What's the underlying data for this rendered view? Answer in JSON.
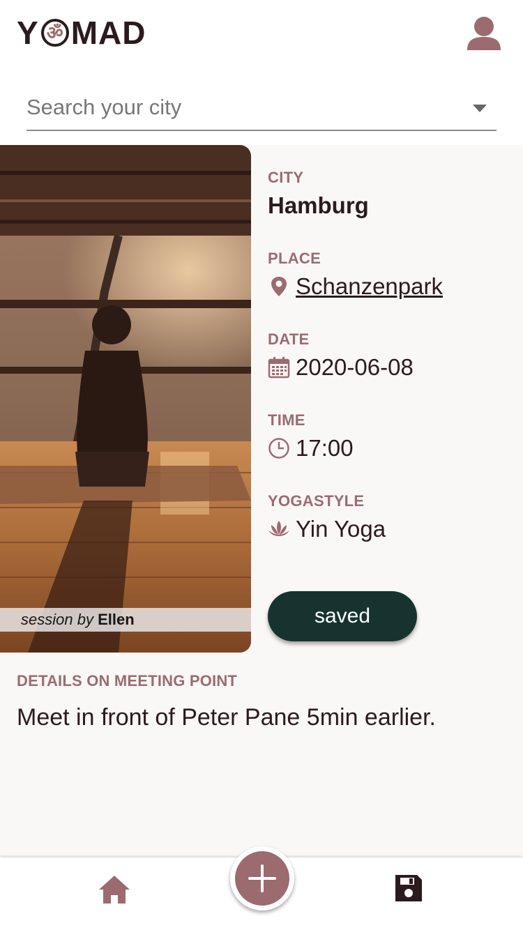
{
  "header": {
    "logo": {
      "letter_y": "Y",
      "om_glyph": "ॐ",
      "letters_rest": "MAD"
    },
    "icons": {
      "profile": "user-icon"
    }
  },
  "search": {
    "placeholder": "Search your city",
    "value": "",
    "dropdown_icon": "caret-down-icon"
  },
  "session": {
    "credit_prefix": "session by",
    "credit_name": "Ellen",
    "city": {
      "label": "CITY",
      "value": "Hamburg"
    },
    "place": {
      "label": "PLACE",
      "value": "Schanzenpark",
      "icon": "map-pin-icon"
    },
    "date": {
      "label": "DATE",
      "value": "2020-06-08",
      "icon": "calendar-icon"
    },
    "time": {
      "label": "TIME",
      "value": "17:00",
      "icon": "clock-icon"
    },
    "yogastyle": {
      "label": "YOGASTYLE",
      "value": "Yin Yoga",
      "icon": "lotus-icon"
    },
    "saved_button": "saved",
    "details_label": "DETAILS ON MEETING POINT",
    "details_text": "Meet in front of Peter Pane 5min earlier."
  },
  "bottom_nav": {
    "home_icon": "home-icon",
    "add_icon": "plus-icon",
    "save_icon": "floppy-disk-icon"
  },
  "colors": {
    "accent": "#9b6b72",
    "text": "#2b1a1e",
    "saved_button_bg": "#17332f",
    "card_bg": "#faf8f7",
    "add_button": "#9b6b6f"
  }
}
